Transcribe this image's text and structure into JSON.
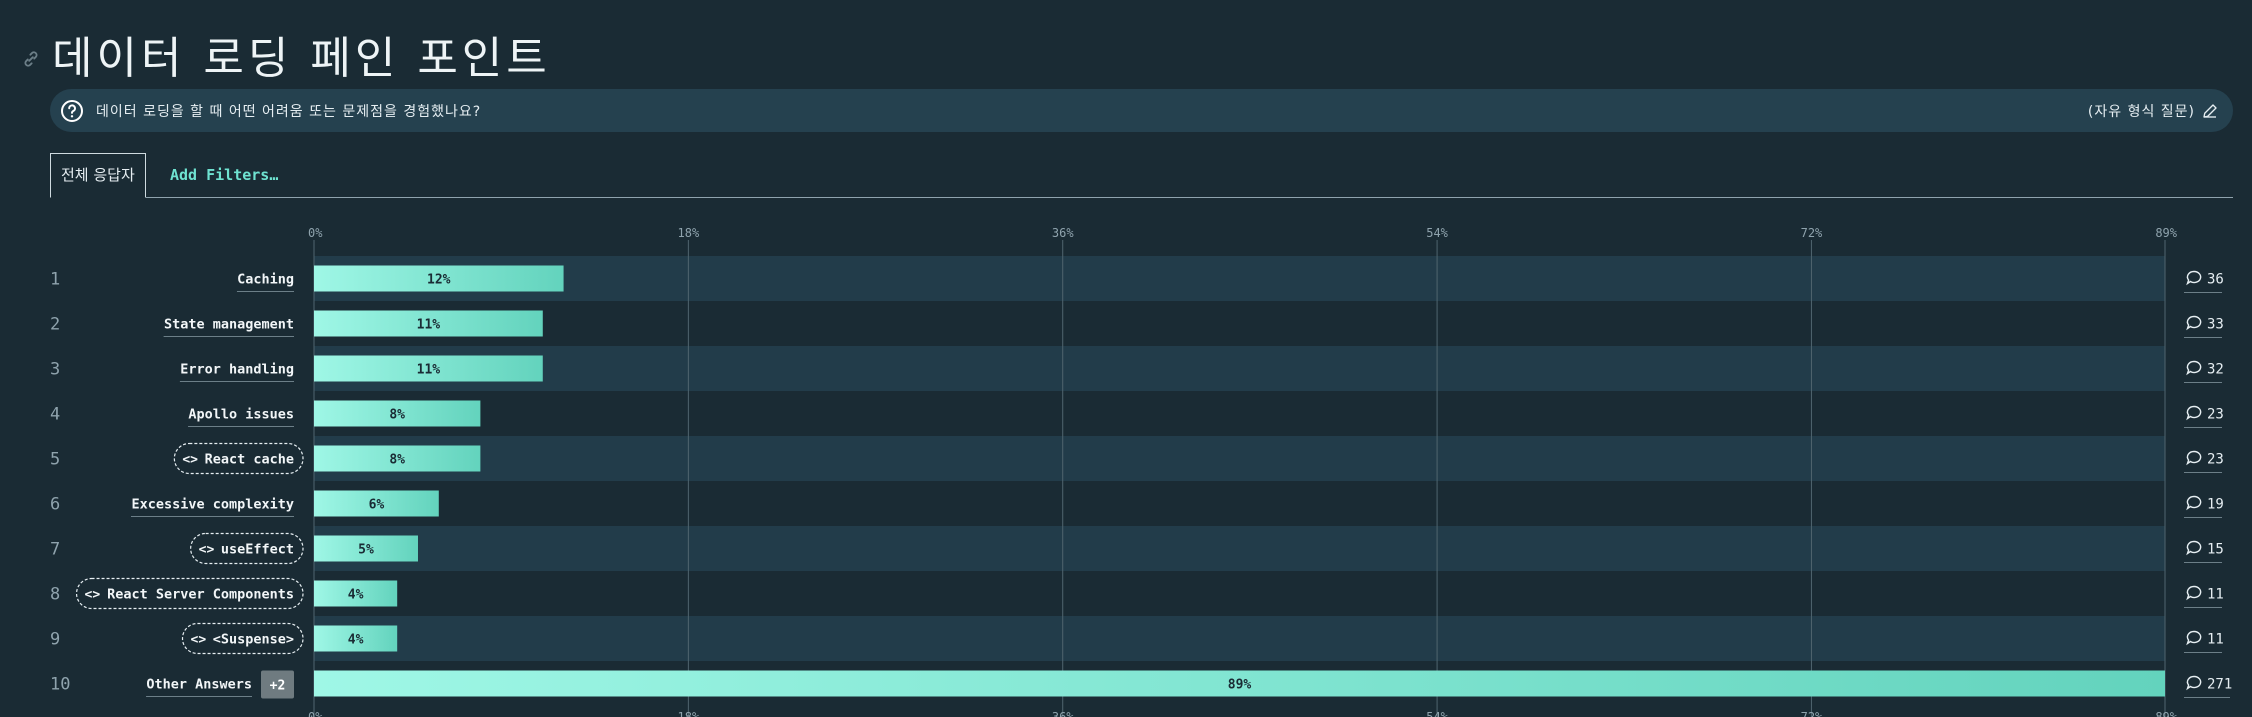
{
  "page": {
    "title": "데이터 로딩 페인 포인트",
    "question": "데이터 로딩을 할 때 어떤 어려움 또는 문제점을 경험했나요?",
    "question_type": "(자유 형식 질문)"
  },
  "tabs": {
    "active": "전체 응답자",
    "add_filters": "Add Filters…"
  },
  "icons": {
    "title": "link-icon",
    "question": "question-circle-icon",
    "edit": "pencil-icon",
    "count": "comment-bubble-icon",
    "code": "code-brackets-icon"
  },
  "colors": {
    "background": "#1a2b34",
    "band": "#223c4a",
    "bar_start": "#9ff7e6",
    "bar_end": "#63d3bd",
    "accent": "#6fe3d1"
  },
  "chart_data": {
    "type": "bar",
    "orientation": "horizontal",
    "xlim": [
      0,
      89
    ],
    "x_ticks": [
      "0%",
      "18%",
      "36%",
      "54%",
      "72%",
      "89%"
    ],
    "x_tick_values": [
      0,
      18,
      36,
      54,
      72,
      89
    ],
    "grid": true,
    "categories": [
      {
        "rank": "1",
        "label": "Caching",
        "value": 12,
        "value_label": "12%",
        "count": "36",
        "code": false
      },
      {
        "rank": "2",
        "label": "State management",
        "value": 11,
        "value_label": "11%",
        "count": "33",
        "code": false
      },
      {
        "rank": "3",
        "label": "Error handling",
        "value": 11,
        "value_label": "11%",
        "count": "32",
        "code": false
      },
      {
        "rank": "4",
        "label": "Apollo issues",
        "value": 8,
        "value_label": "8%",
        "count": "23",
        "code": false
      },
      {
        "rank": "5",
        "label": "React cache",
        "value": 8,
        "value_label": "8%",
        "count": "23",
        "code": true
      },
      {
        "rank": "6",
        "label": "Excessive complexity",
        "value": 6,
        "value_label": "6%",
        "count": "19",
        "code": false
      },
      {
        "rank": "7",
        "label": "useEffect",
        "value": 5,
        "value_label": "5%",
        "count": "15",
        "code": true
      },
      {
        "rank": "8",
        "label": "React Server Components",
        "value": 4,
        "value_label": "4%",
        "count": "11",
        "code": true
      },
      {
        "rank": "9",
        "label": "<Suspense>",
        "value": 4,
        "value_label": "4%",
        "count": "11",
        "code": true
      },
      {
        "rank": "10",
        "label": "Other Answers",
        "value": 89,
        "value_label": "89%",
        "count": "271",
        "code": false,
        "badge": "+2"
      }
    ]
  }
}
